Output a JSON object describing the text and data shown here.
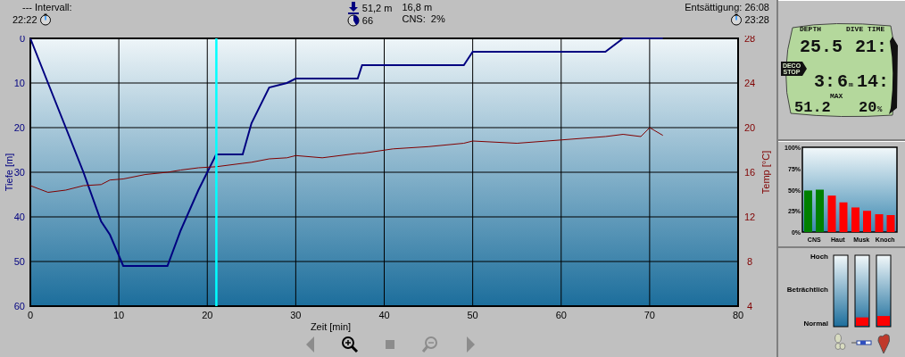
{
  "header": {
    "interval_label": "--- Intervall:",
    "interval_time": "22:22",
    "max_depth": "51,2 m",
    "avg_depth": "16,8 m",
    "dive_time": "66",
    "cns": "CNS:  2%",
    "desaturation": "Entsättigung: 26:08",
    "end_time": "23:28"
  },
  "profile": {
    "chart_data": {
      "type": "line",
      "xlabel": "Zeit [min]",
      "ylabel": "Tiefe [m]",
      "y2label": "Temp [°C]",
      "x": [
        0,
        2,
        4,
        6,
        8,
        9,
        10.5,
        13,
        15.5,
        17,
        19,
        21,
        24,
        25,
        27,
        29,
        30,
        33,
        37,
        37.5,
        41,
        45,
        49,
        50,
        55,
        60,
        65,
        67,
        69,
        70,
        71.5
      ],
      "series": [
        {
          "color": "#000080",
          "values": [
            0,
            10,
            20,
            30,
            41,
            44,
            51,
            51,
            51,
            43,
            34,
            26,
            26,
            19,
            11,
            10,
            9,
            9,
            9,
            6,
            6,
            6,
            6,
            3,
            3,
            3,
            3,
            0,
            0,
            0,
            0
          ]
        },
        {
          "color": "#800000",
          "axis": "y2",
          "values": [
            14.8,
            14.2,
            14.4,
            14.8,
            14.9,
            15.3,
            15.4,
            15.8,
            16,
            16.2,
            16.4,
            16.5,
            16.8,
            16.9,
            17.2,
            17.3,
            17.5,
            17.3,
            17.7,
            17.7,
            18.1,
            18.3,
            18.6,
            18.8,
            18.6,
            18.9,
            19.2,
            19.4,
            19.2,
            20,
            19.3
          ]
        }
      ],
      "xlim": [
        0,
        80
      ],
      "ylim": [
        60,
        0
      ],
      "y2lim": [
        4,
        28
      ],
      "xticks": [
        0,
        10,
        20,
        30,
        40,
        50,
        60,
        70,
        80
      ],
      "yticks": [
        0,
        10,
        20,
        30,
        40,
        50,
        60
      ],
      "y2ticks": [
        4,
        8,
        12,
        16,
        20,
        24,
        28
      ],
      "grid": true,
      "ref_lines": [
        {
          "axis": "x",
          "value": 21,
          "color": "#00ffff"
        }
      ]
    }
  },
  "computer_display": {
    "depth_label": "DEPTH",
    "time_label": "DIVE TIME",
    "depth": "25.5",
    "time": "21:",
    "deco_label_1": "DECO",
    "deco_label_2": "STOP",
    "stop_time": "3:",
    "stop_depth": "6",
    "stop_unit": "m",
    "temp": "14:",
    "max_depth": "51.2",
    "max_label": "MAX",
    "o2": "20",
    "o2_unit": "%"
  },
  "tissue_chart": {
    "chart_data": {
      "type": "bar",
      "categories": [
        "CNS",
        "Haut",
        "Musk",
        "Knoch"
      ],
      "ylim": [
        0,
        100
      ],
      "yticks": [
        {
          "value": 0,
          "label": "0%"
        },
        {
          "value": 25,
          "label": "25%"
        },
        {
          "value": 50,
          "label": "50%"
        },
        {
          "value": 75,
          "label": "75%"
        },
        {
          "value": 100,
          "label": "100%"
        }
      ],
      "series": [
        {
          "colors": [
            "#008000",
            "#ff0000",
            "#ff0000",
            "#ff0000"
          ],
          "values": [
            49,
            43,
            29,
            21
          ]
        },
        {
          "colors": [
            "#008000",
            "#ff0000",
            "#ff0000",
            "#ff0000"
          ],
          "values": [
            50,
            35,
            25,
            20
          ]
        }
      ]
    }
  },
  "stress_gauges": {
    "labels": [
      "Hoch",
      "Beträchtlich",
      "Normal"
    ]
  },
  "toolbar": [
    {
      "kind": "prev",
      "disabled": true
    },
    {
      "kind": "zoom_in",
      "disabled": false
    },
    {
      "kind": "stop",
      "disabled": true
    },
    {
      "kind": "zoom_out",
      "disabled": true
    },
    {
      "kind": "next",
      "disabled": true
    }
  ]
}
